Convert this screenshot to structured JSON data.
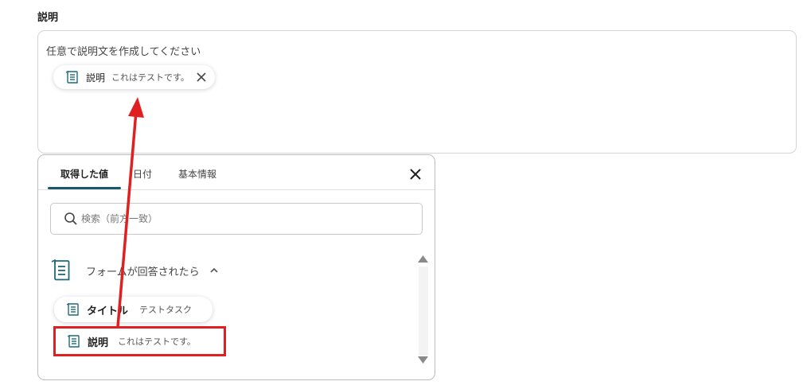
{
  "description_field": {
    "label": "説明",
    "placeholder": "任意で説明文を作成してください",
    "chip": {
      "label": "説明",
      "value": "これはテストです。",
      "icon": "document-icon"
    }
  },
  "picker": {
    "tabs": [
      {
        "label": "取得した値",
        "active": true
      },
      {
        "label": "日付",
        "active": false
      },
      {
        "label": "基本情報",
        "active": false
      }
    ],
    "close_icon": "close-icon",
    "search": {
      "placeholder": "検索（前方一致）",
      "value": ""
    },
    "group": {
      "label": "フォームが回答されたら",
      "expanded": true,
      "items": [
        {
          "label": "タイトル",
          "value": "テストタスク"
        },
        {
          "label": "説明",
          "value": "これはテストです。"
        }
      ]
    }
  },
  "annotation": {
    "color": "#e02020",
    "highlight": "picker.group.items.1",
    "arrow_target": "description_field.chip"
  },
  "colors": {
    "accent": "#17586e",
    "icon": "#1e6a7a",
    "annotation_red": "#e02020"
  }
}
